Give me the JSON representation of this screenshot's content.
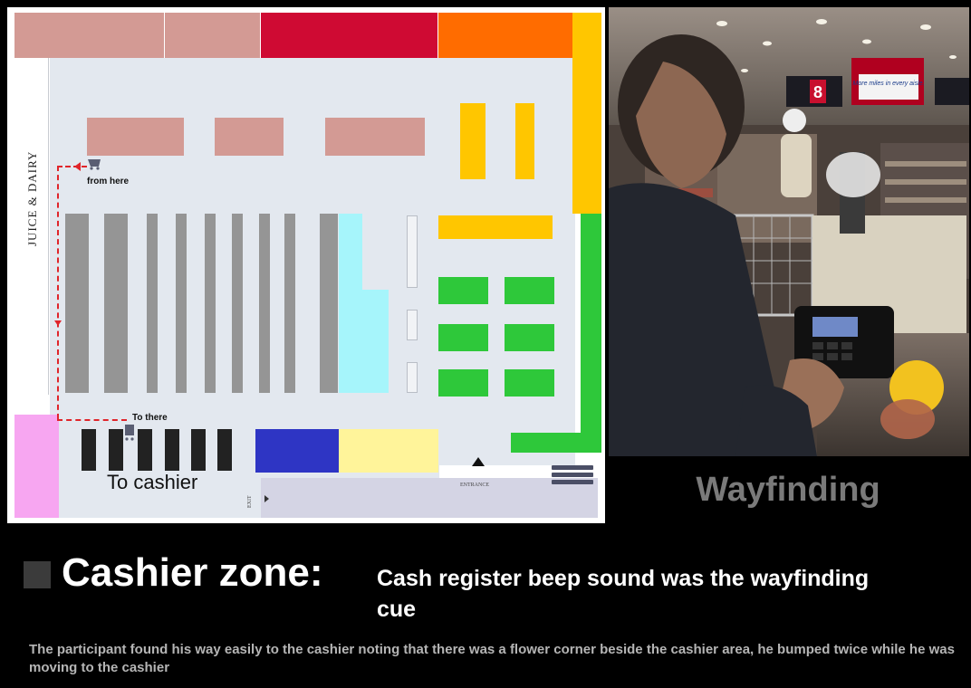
{
  "map": {
    "side_label": "JUICE & DAIRY",
    "start_label": "from here",
    "end_label": "To there",
    "cashier_label": "To cashier",
    "entrance_label": "ENTRANCE",
    "exit_label": "EXIT",
    "colors": {
      "route": "#e0242a",
      "top_pink": "#d39a94",
      "top_red": "#cf0a33",
      "top_orange": "#ff6c00",
      "yellow": "#ffc600",
      "green": "#2ec83a",
      "light_blue": "#a6f5fb",
      "blue": "#2e35c4",
      "pale_yellow": "#fff49a",
      "pink": "#f7a6f1"
    }
  },
  "photo": {
    "sign_aisle_number": "8",
    "sign_slogan": "More miles in every aisle."
  },
  "wayfinding_label": "Wayfinding",
  "zone": {
    "title": "Cashier zone:",
    "cue": "Cash register beep sound was the wayfinding cue"
  },
  "caption": "The participant found his way easily to the cashier noting that there was a flower corner beside the cashier area, he bumped twice while he was moving to the cashier"
}
